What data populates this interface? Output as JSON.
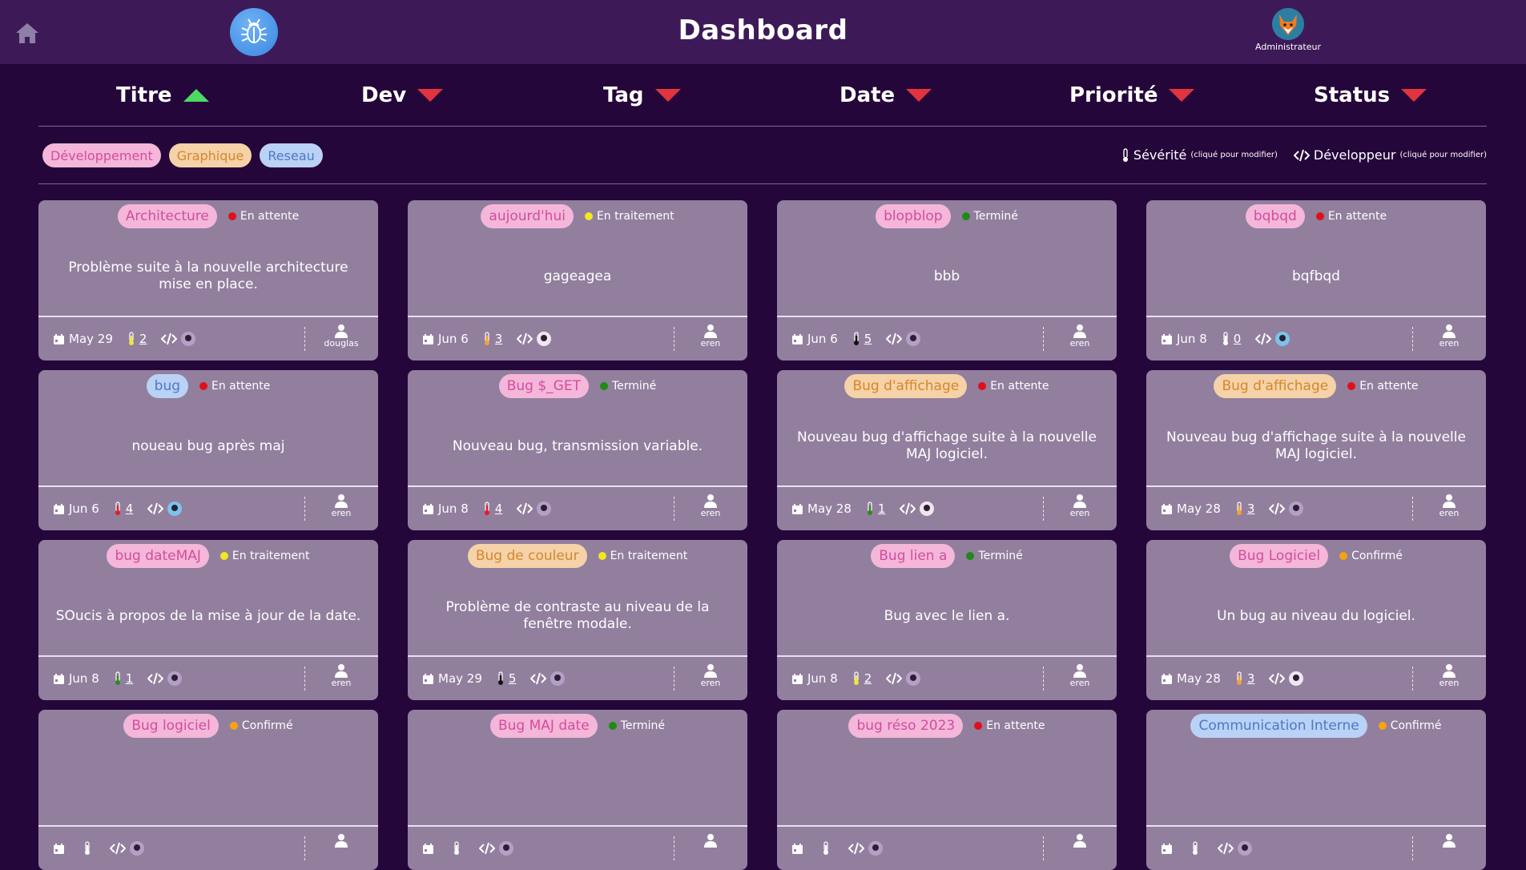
{
  "header": {
    "title": "Dashboard",
    "user_name": "Administrateur",
    "icons": [
      "home-icon",
      "bug-icon",
      "fox-avatar"
    ]
  },
  "sort": [
    {
      "label": "Titre",
      "dir": "up"
    },
    {
      "label": "Dev",
      "dir": "down"
    },
    {
      "label": "Tag",
      "dir": "down"
    },
    {
      "label": "Date",
      "dir": "down"
    },
    {
      "label": "Priorité",
      "dir": "down"
    },
    {
      "label": "Status",
      "dir": "down"
    }
  ],
  "filters": [
    {
      "label": "Développement",
      "color": "pink"
    },
    {
      "label": "Graphique",
      "color": "orange"
    },
    {
      "label": "Reseau",
      "color": "blue"
    }
  ],
  "legend": {
    "severity": "Sévérité",
    "severity_hint": "(cliqué pour modifier)",
    "developer": "Développeur",
    "developer_hint": "(cliqué pour modifier)"
  },
  "colors": {
    "status": {
      "En attente": "#e0101b",
      "En traitement": "#f2e81c",
      "Terminé": "#1f8a15",
      "Confirmé": "#f5a30f"
    },
    "severity": {
      "0": "#ffffff",
      "1": "#2f8a1f",
      "2": "#f0e62f",
      "3": "#f5a030",
      "4": "#e01e2a",
      "5": "#111111"
    }
  },
  "cards": [
    {
      "tag": "Architecture",
      "tag_color": "pink",
      "status": "En attente",
      "desc": "Problème suite à la nouvelle architecture mise en place.",
      "date": "May 29",
      "severity": "2",
      "avatar": "purple",
      "dev": "douglas"
    },
    {
      "tag": "aujourd'hui",
      "tag_color": "pink",
      "status": "En traitement",
      "desc": "gageagea",
      "date": "Jun 6",
      "severity": "3",
      "avatar": "white",
      "dev": "eren"
    },
    {
      "tag": "blopblop",
      "tag_color": "pink",
      "status": "Terminé",
      "desc": "bbb",
      "date": "Jun 6",
      "severity": "5",
      "avatar": "purple",
      "dev": "eren"
    },
    {
      "tag": "bqbqd",
      "tag_color": "pink",
      "status": "En attente",
      "desc": "bqfbqd",
      "date": "Jun 8",
      "severity": "0",
      "avatar": "blue",
      "dev": "eren"
    },
    {
      "tag": "bug",
      "tag_color": "blue",
      "status": "En attente",
      "desc": "noueau bug après maj",
      "date": "Jun 6",
      "severity": "4",
      "avatar": "blue",
      "dev": "eren"
    },
    {
      "tag": "Bug $_GET",
      "tag_color": "pink",
      "status": "Terminé",
      "desc": "Nouveau bug, transmission variable.",
      "date": "Jun 8",
      "severity": "4",
      "avatar": "purple",
      "dev": "eren"
    },
    {
      "tag": "Bug d'affichage",
      "tag_color": "orange",
      "status": "En attente",
      "desc": "Nouveau bug d'affichage suite à la nouvelle MAJ logiciel.",
      "date": "May 28",
      "severity": "1",
      "avatar": "white",
      "dev": "eren"
    },
    {
      "tag": "Bug d'affichage",
      "tag_color": "orange",
      "status": "En attente",
      "desc": "Nouveau bug d'affichage suite à la nouvelle MAJ logiciel.",
      "date": "May 28",
      "severity": "3",
      "avatar": "purple",
      "dev": "eren"
    },
    {
      "tag": "bug dateMAJ",
      "tag_color": "pink",
      "status": "En traitement",
      "desc": "SOucis à propos de la mise à jour de la date.",
      "date": "Jun 8",
      "severity": "1",
      "avatar": "purple",
      "dev": "eren"
    },
    {
      "tag": "Bug de couleur",
      "tag_color": "orange",
      "status": "En traitement",
      "desc": "Problème de contraste au niveau de la fenêtre modale.",
      "date": "May 29",
      "severity": "5",
      "avatar": "purple",
      "dev": "eren"
    },
    {
      "tag": "Bug lien a",
      "tag_color": "pink",
      "status": "Terminé",
      "desc": "Bug avec le lien a.",
      "date": "Jun 8",
      "severity": "2",
      "avatar": "purple",
      "dev": "eren"
    },
    {
      "tag": "Bug Logiciel",
      "tag_color": "pink",
      "status": "Confirmé",
      "desc": "Un bug au niveau du logiciel.",
      "date": "May 28",
      "severity": "3",
      "avatar": "white",
      "dev": "eren"
    },
    {
      "tag": "Bug logiciel",
      "tag_color": "pink",
      "status": "Confirmé",
      "desc": "",
      "date": "",
      "severity": "",
      "avatar": "purple",
      "dev": ""
    },
    {
      "tag": "Bug MAJ date",
      "tag_color": "pink",
      "status": "Terminé",
      "desc": "",
      "date": "",
      "severity": "",
      "avatar": "purple",
      "dev": ""
    },
    {
      "tag": "bug réso 2023",
      "tag_color": "pink",
      "status": "En attente",
      "desc": "",
      "date": "",
      "severity": "",
      "avatar": "purple",
      "dev": ""
    },
    {
      "tag": "Communication Interne",
      "tag_color": "blue",
      "status": "Confirmé",
      "desc": "",
      "date": "",
      "severity": "",
      "avatar": "purple",
      "dev": ""
    }
  ]
}
